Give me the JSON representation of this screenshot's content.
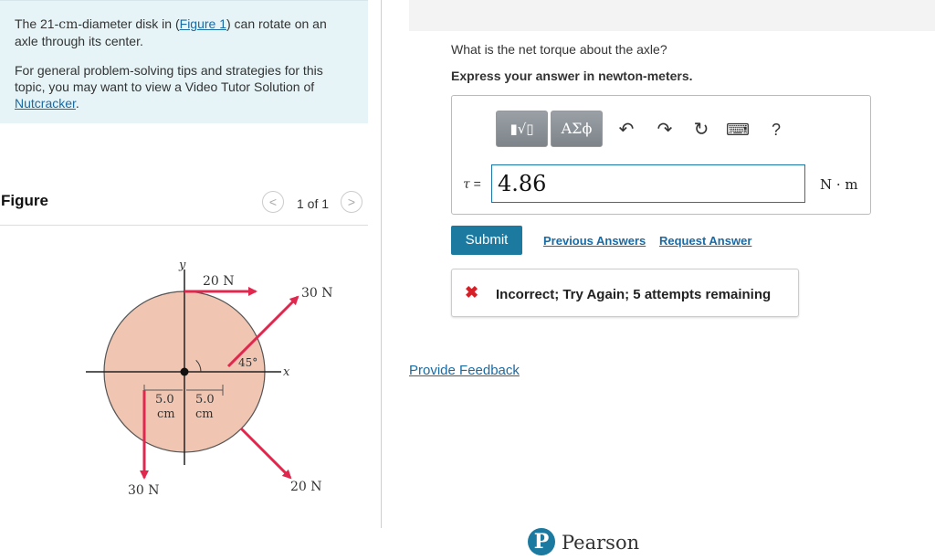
{
  "intro": {
    "para1_pre": "The 21-",
    "para1_unit": "cm",
    "para1_mid": "-diameter disk in (",
    "para1_link": "Figure 1",
    "para1_post": ") can rotate on an axle through its center.",
    "para2_pre": "For general problem-solving tips and strategies for this topic, you may want to view a Video Tutor Solution of ",
    "para2_link": "Nutcracker",
    "para2_post": "."
  },
  "figure_panel": {
    "title": "Figure",
    "prev_symbol": "<",
    "next_symbol": ">",
    "count": "1 of 1"
  },
  "figure": {
    "y_label": "y",
    "x_label": "x",
    "angle_label": "45°",
    "force_top": "20 N",
    "force_upper_right": "30 N",
    "force_lower_right": "20 N",
    "force_left": "30 N",
    "dist_left_value": "5.0",
    "dist_left_unit": "cm",
    "dist_right_value": "5.0",
    "dist_right_unit": "cm",
    "colors": {
      "disk": "#f0c6b3",
      "arrow": "#e0284f"
    }
  },
  "question": {
    "text": "What is the net torque about the axle?",
    "instruction": "Express your answer in newton-meters."
  },
  "answer": {
    "toolbar": {
      "templates_icon": "fraction-sqrt-icon",
      "templates_label": "▮√▯",
      "greek_label": "ΑΣϕ",
      "undo_icon": "↶",
      "redo_icon": "↷",
      "reset_icon": "↻",
      "keyboard_icon": "⌨",
      "help_icon": "?"
    },
    "variable": "τ",
    "equals": " =",
    "value": "4.86",
    "unit": "N · m"
  },
  "actions": {
    "submit": "Submit",
    "previous_answers": "Previous Answers",
    "request_answer": "Request Answer"
  },
  "feedback": {
    "icon": "✖",
    "message": "Incorrect; Try Again; 5 attempts remaining"
  },
  "provide_feedback": "Provide Feedback",
  "footer": {
    "logo_letter": "P",
    "brand": "Pearson"
  }
}
